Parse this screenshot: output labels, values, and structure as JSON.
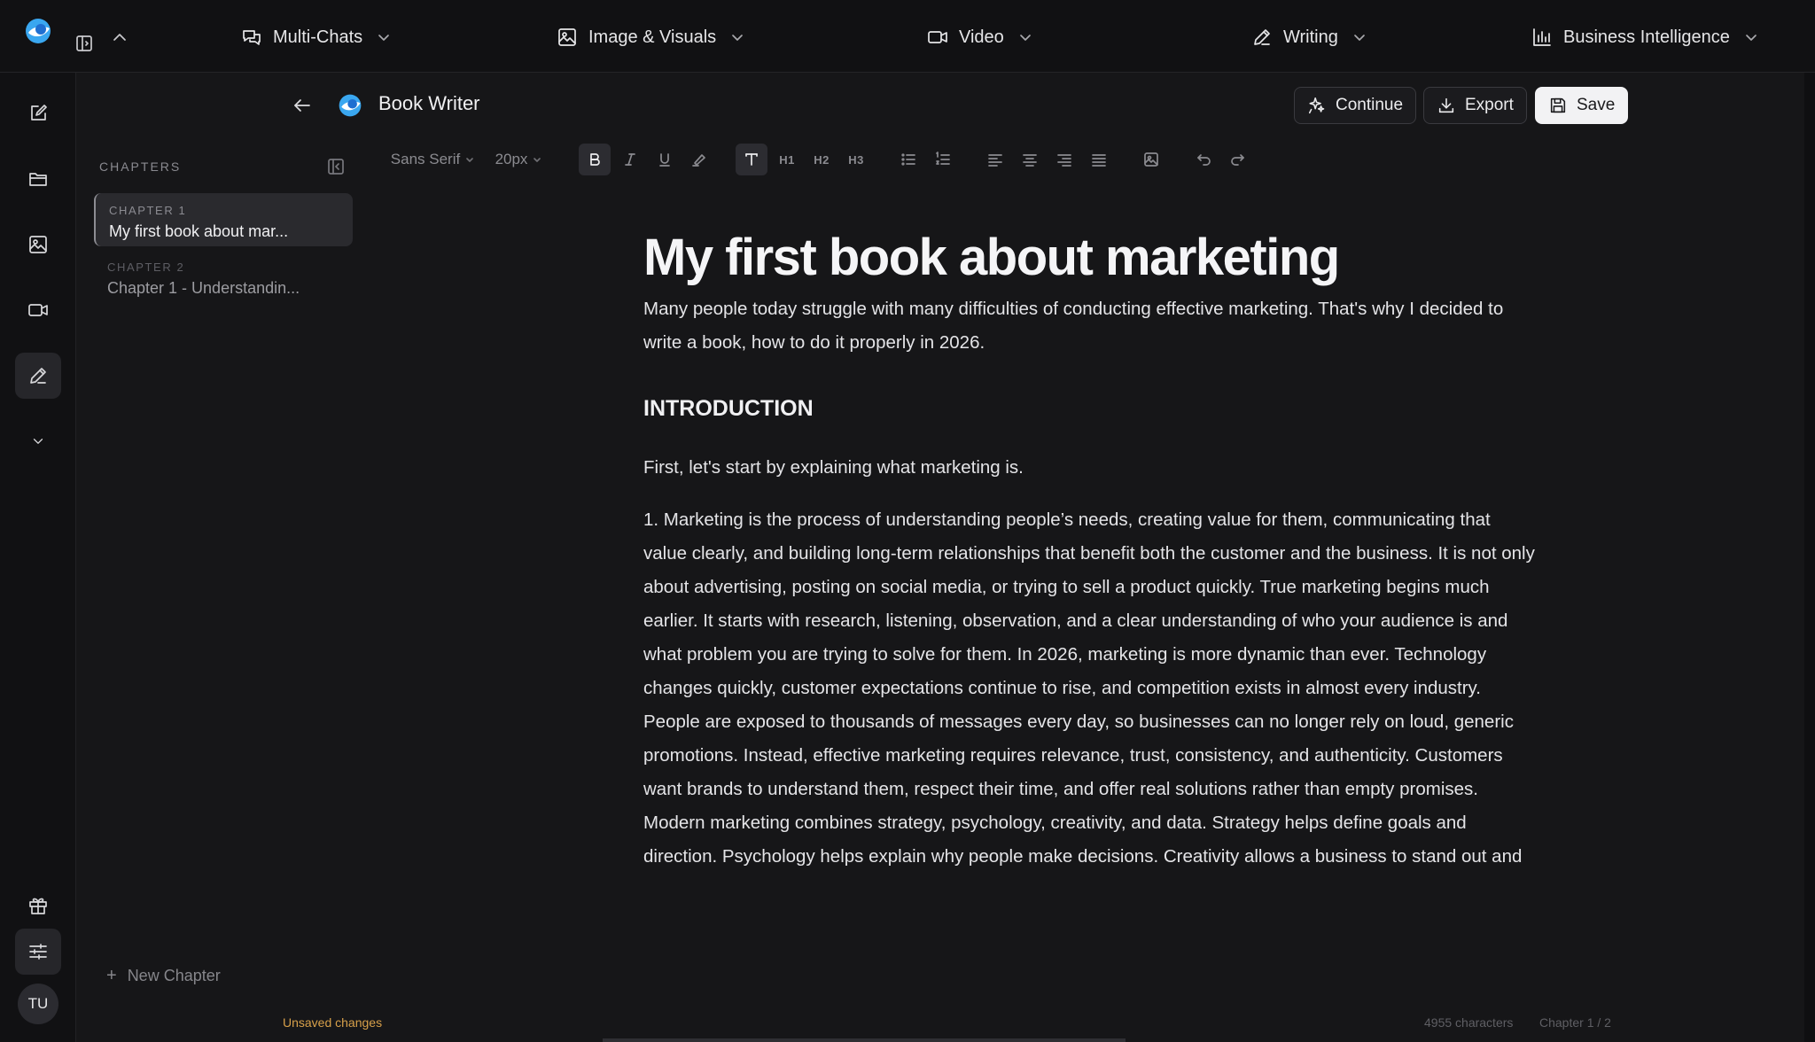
{
  "topnav": [
    {
      "label": "Multi-Chats",
      "icon": "chat-bubbles-icon"
    },
    {
      "label": "Image & Visuals",
      "icon": "image-icon"
    },
    {
      "label": "Video",
      "icon": "video-camera-icon"
    },
    {
      "label": "Writing",
      "icon": "pen-icon"
    },
    {
      "label": "Business Intelligence",
      "icon": "bar-chart-icon"
    }
  ],
  "rail": {
    "items": [
      "edit-icon",
      "folder-icon",
      "image-icon",
      "video-icon",
      "pen-icon",
      "chevron-down-icon"
    ],
    "bottom": [
      "gift-icon",
      "sliders-icon"
    ],
    "avatar": "TU"
  },
  "doc": {
    "title": "Book Writer"
  },
  "chapters": {
    "heading": "CHAPTERS",
    "items": [
      {
        "number": "CHAPTER 1",
        "title": "My first book about mar..."
      },
      {
        "number": "CHAPTER 2",
        "title": "Chapter 1 - Understandin..."
      }
    ],
    "new_label": "New Chapter",
    "unsaved": "Unsaved changes"
  },
  "actions": {
    "continue": "Continue",
    "export": "Export",
    "save": "Save"
  },
  "toolbar": {
    "font": "Sans Serif",
    "size": "20px",
    "h1": "H1",
    "h2": "H2",
    "h3": "H3"
  },
  "content": {
    "title": "My first book about marketing",
    "intro": "Many people today struggle with many difficulties of conducting effective marketing. That's why I decided to write a book, how to do it properly in 2026.",
    "heading": "INTRODUCTION",
    "first": "First, let's start by explaining what marketing is.",
    "body": "1. Marketing is the process of understanding people’s needs, creating value for them, communicating that value clearly, and building long-term relationships that benefit both the customer and the business. It is not only about advertising, posting on social media, or trying to sell a product quickly. True marketing begins much earlier. It starts with research, listening, observation, and a clear understanding of who your audience is and what problem you are trying to solve for them. In 2026, marketing is more dynamic than ever. Technology changes quickly, customer expectations continue to rise, and competition exists in almost every industry. People are exposed to thousands of messages every day, so businesses can no longer rely on loud, generic promotions. Instead, effective marketing requires relevance, trust, consistency, and authenticity. Customers want brands to understand them, respect their time, and offer real solutions rather than empty promises. Modern marketing combines strategy, psychology, creativity, and data. Strategy helps define goals and direction. Psychology helps explain why people make decisions. Creativity allows a business to stand out and capture attention. Data helps measure performance and improve results over time. When these elements work together, marketing becomes a powerful system for growth. It is also important to understand that marketing is not the same as sales, although the two are closely connected. Marketing attracts the right people, builds interest, and creates demand. Sales turns"
  },
  "status": {
    "characters": "4955 characters",
    "chapter_pos": "Chapter 1 / 2"
  }
}
